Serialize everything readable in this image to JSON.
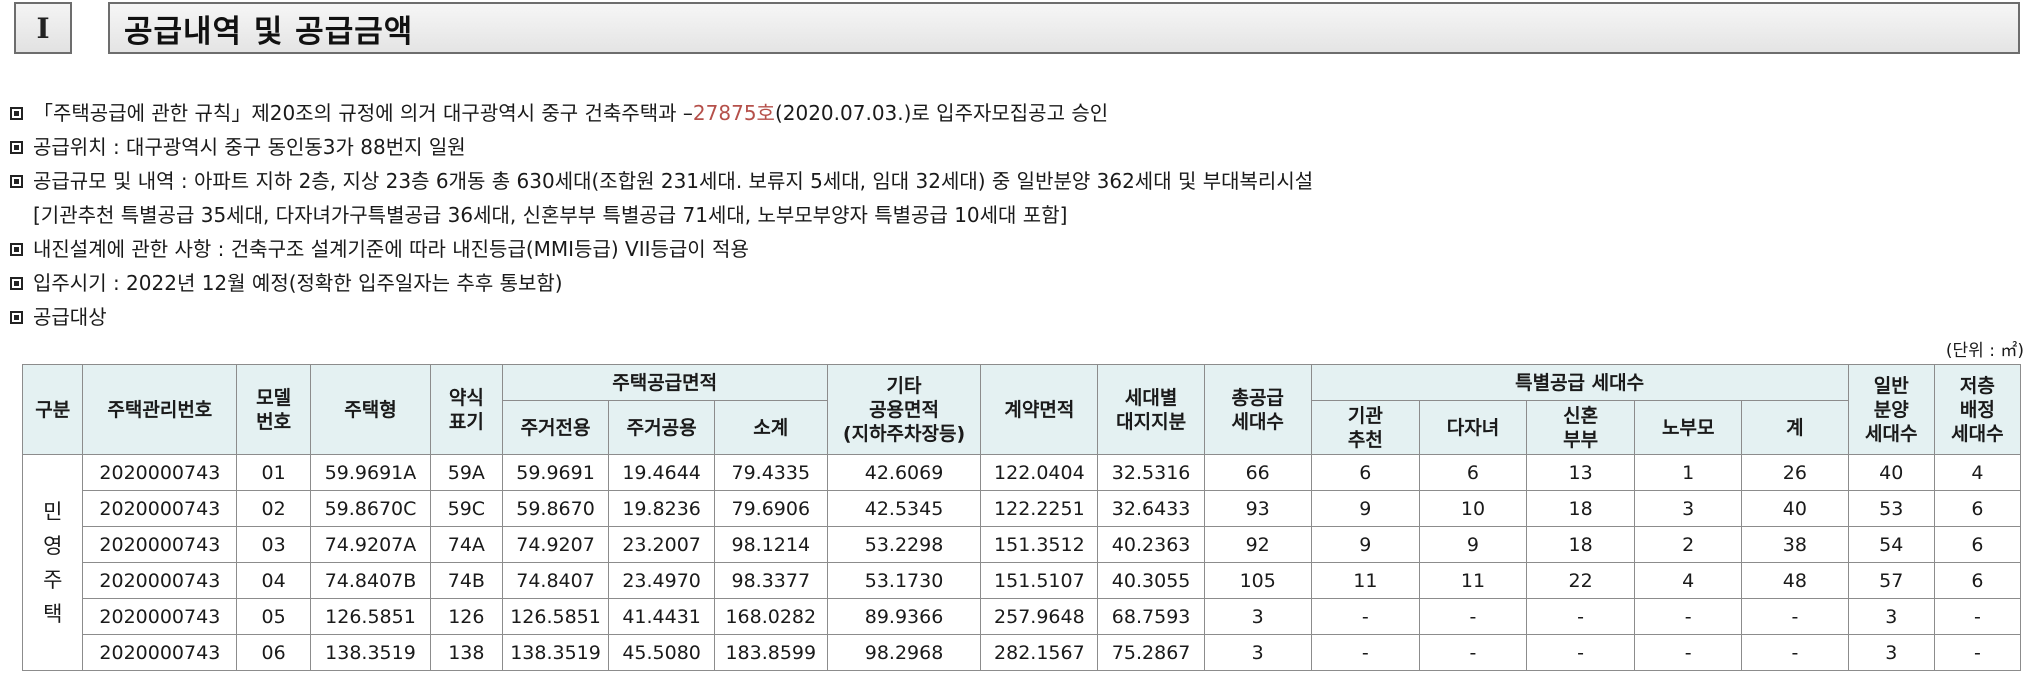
{
  "header": {
    "roman_numeral": "I",
    "title": "공급내역 및 공급금액"
  },
  "bullets": {
    "line1_pre": "「주택공급에 관한 규칙」제20조의 규정에 의거 대구광역시 중구 건축주택과 – ",
    "line1_number": "27875호",
    "line1_post": "(2020.07.03.)로 입주자모집공고 승인",
    "line2": "공급위치 : 대구광역시 중구 동인동3가 88번지 일원",
    "line3": "공급규모 및 내역 : 아파트 지하 2층, 지상 23층 6개동 총 630세대(조합원 231세대. 보류지 5세대, 임대 32세대) 중 일반분양 362세대 및 부대복리시설",
    "line3_cont": "[기관추천 특별공급 35세대, 다자녀가구특별공급 36세대, 신혼부부 특별공급 71세대, 노부모부양자 특별공급 10세대 포함]",
    "line4": "내진설계에 관한 사항 : 건축구조 설계기준에 따라 내진등급(MMI등급) VII등급이 적용",
    "line5": "입주시기 : 2022년 12월 예정(정확한 입주일자는 추후 통보함)",
    "line6": "공급대상"
  },
  "unit_label": "(단위 : ㎡)",
  "table": {
    "headers": {
      "category": "구분",
      "housing_no": "주택관리번호",
      "model_1": "모델",
      "model_2": "번호",
      "type": "주택형",
      "abbr_1": "약식",
      "abbr_2": "표기",
      "area_group": "주택공급면적",
      "exclusive": "주거전용",
      "common": "주거공용",
      "subtotal": "소계",
      "other_1": "기타",
      "other_2": "공용면적",
      "other_3": "(지하주차장등)",
      "contract": "계약면적",
      "land_1": "세대별",
      "land_2": "대지지분",
      "total_1": "총공급",
      "total_2": "세대수",
      "special_group": "특별공급 세대수",
      "inst_1": "기관",
      "inst_2": "추천",
      "multi": "다자녀",
      "newly_1": "신혼",
      "newly_2": "부부",
      "elderly": "노부모",
      "special_sum": "계",
      "general_1": "일반",
      "general_2": "분양",
      "general_3": "세대수",
      "floor_1": "저층",
      "floor_2": "배정",
      "floor_3": "세대수"
    },
    "category_label": [
      "민",
      "영",
      "주",
      "택"
    ],
    "rows": [
      {
        "housing_no": "2020000743",
        "model": "01",
        "type": "59.9691A",
        "abbr": "59A",
        "exclusive": "59.9691",
        "common": "19.4644",
        "subtotal": "79.4335",
        "other": "42.6069",
        "contract": "122.0404",
        "land": "32.5316",
        "total": "66",
        "inst": "6",
        "multi": "6",
        "newly": "13",
        "elderly": "1",
        "special_sum": "26",
        "general": "40",
        "floor": "4"
      },
      {
        "housing_no": "2020000743",
        "model": "02",
        "type": "59.8670C",
        "abbr": "59C",
        "exclusive": "59.8670",
        "common": "19.8236",
        "subtotal": "79.6906",
        "other": "42.5345",
        "contract": "122.2251",
        "land": "32.6433",
        "total": "93",
        "inst": "9",
        "multi": "10",
        "newly": "18",
        "elderly": "3",
        "special_sum": "40",
        "general": "53",
        "floor": "6"
      },
      {
        "housing_no": "2020000743",
        "model": "03",
        "type": "74.9207A",
        "abbr": "74A",
        "exclusive": "74.9207",
        "common": "23.2007",
        "subtotal": "98.1214",
        "other": "53.2298",
        "contract": "151.3512",
        "land": "40.2363",
        "total": "92",
        "inst": "9",
        "multi": "9",
        "newly": "18",
        "elderly": "2",
        "special_sum": "38",
        "general": "54",
        "floor": "6"
      },
      {
        "housing_no": "2020000743",
        "model": "04",
        "type": "74.8407B",
        "abbr": "74B",
        "exclusive": "74.8407",
        "common": "23.4970",
        "subtotal": "98.3377",
        "other": "53.1730",
        "contract": "151.5107",
        "land": "40.3055",
        "total": "105",
        "inst": "11",
        "multi": "11",
        "newly": "22",
        "elderly": "4",
        "special_sum": "48",
        "general": "57",
        "floor": "6"
      },
      {
        "housing_no": "2020000743",
        "model": "05",
        "type": "126.5851",
        "abbr": "126",
        "exclusive": "126.5851",
        "common": "41.4431",
        "subtotal": "168.0282",
        "other": "89.9366",
        "contract": "257.9648",
        "land": "68.7593",
        "total": "3",
        "inst": "-",
        "multi": "-",
        "newly": "-",
        "elderly": "-",
        "special_sum": "-",
        "general": "3",
        "floor": "-"
      },
      {
        "housing_no": "2020000743",
        "model": "06",
        "type": "138.3519",
        "abbr": "138",
        "exclusive": "138.3519",
        "common": "45.5080",
        "subtotal": "183.8599",
        "other": "98.2968",
        "contract": "282.1567",
        "land": "75.2867",
        "total": "3",
        "inst": "-",
        "multi": "-",
        "newly": "-",
        "elderly": "-",
        "special_sum": "-",
        "general": "3",
        "floor": "-"
      }
    ]
  }
}
